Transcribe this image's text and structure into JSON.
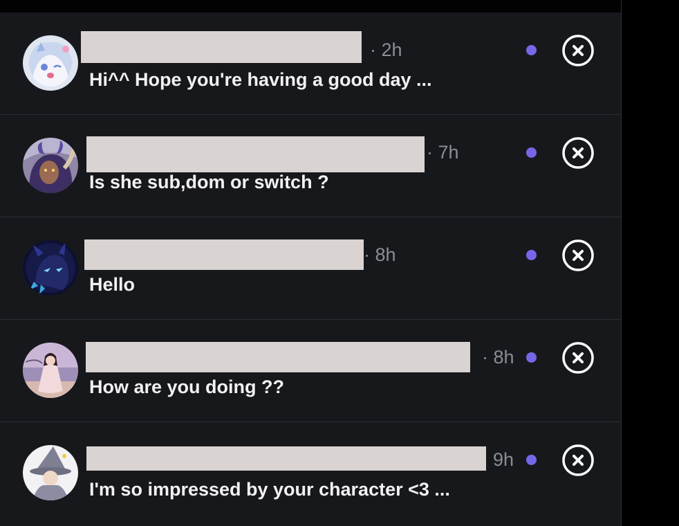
{
  "colors": {
    "panel_bg": "#17181c",
    "divider": "#2b2d33",
    "text": "#f1f1f3",
    "muted": "#8b8d94",
    "unread_dot": "#7667e8",
    "redaction": "#d9d3d2"
  },
  "notifications": [
    {
      "time": "· 2h",
      "message": "Hi^^ Hope you're having a good day ...",
      "unread": true,
      "avatar_icon": "anime-avatar-white-hair"
    },
    {
      "time": "· 7h",
      "message": "Is she sub,dom or switch ?",
      "unread": true,
      "avatar_icon": "anime-avatar-horned-purple"
    },
    {
      "time": "· 8h",
      "message": "Hello",
      "unread": true,
      "avatar_icon": "dragon-avatar-dark-blue"
    },
    {
      "time": "· 8h",
      "message": "How are you doing ??",
      "unread": true,
      "avatar_icon": "anime-avatar-beach-girl"
    },
    {
      "time": "9h",
      "message": "I'm so impressed by your character <3 ...",
      "unread": true,
      "avatar_icon": "wizard-avatar-grey"
    }
  ]
}
